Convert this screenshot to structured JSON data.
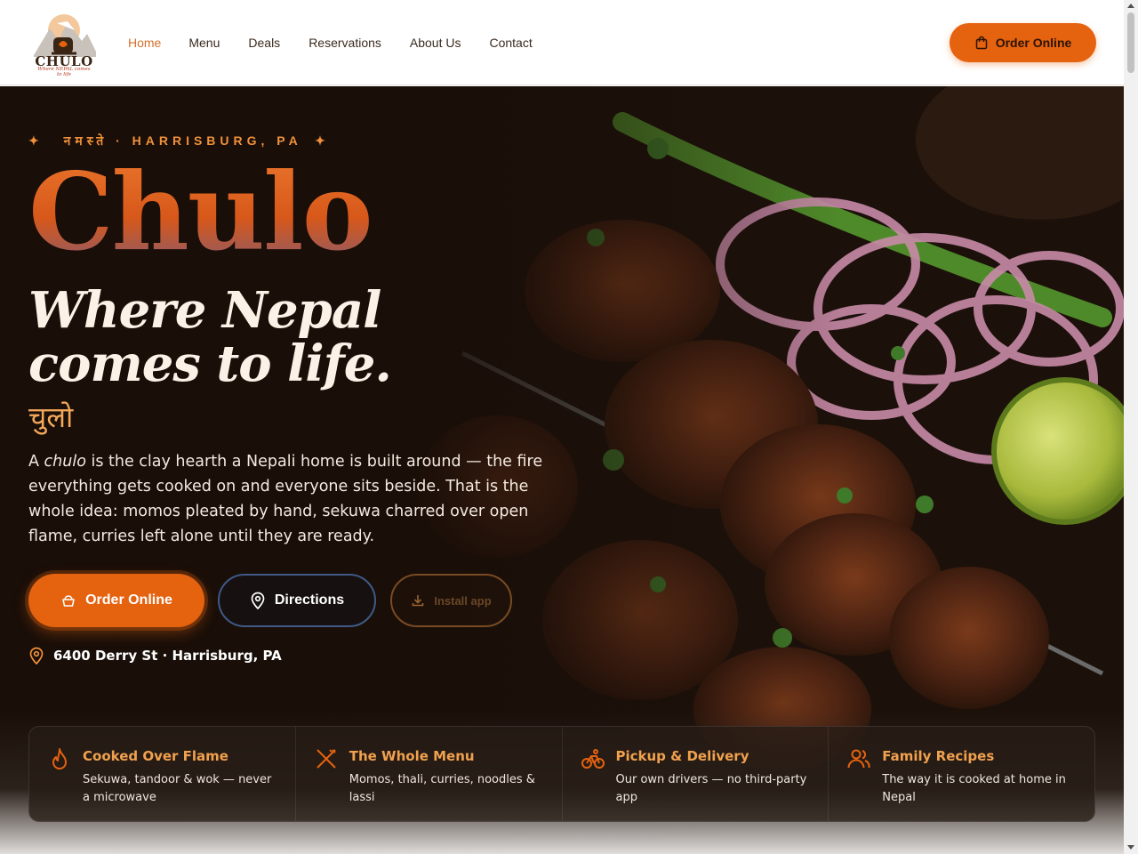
{
  "brand": {
    "logo_word": "CHULO",
    "logo_sub": "Where NEPAL comes to life"
  },
  "nav": {
    "items": [
      {
        "label": "Home",
        "active": true
      },
      {
        "label": "Menu"
      },
      {
        "label": "Deals"
      },
      {
        "label": "Reservations"
      },
      {
        "label": "About Us"
      },
      {
        "label": "Contact"
      }
    ],
    "order_button": "Order Online"
  },
  "hero": {
    "eyebrow": "नमस्ते · HARRISBURG, PA",
    "title": "Chulo",
    "tagline_line1": "Where Nepal",
    "tagline_line2": "comes to life.",
    "devanagari": "चुलो",
    "intro_prefix": "A ",
    "intro_em": "chulo",
    "intro_rest": " is the clay hearth a Nepali home is built around — the fire everything gets cooked on and everyone sits beside. That is the whole idea: momos pleated by hand, sekuwa charred over open flame, curries left alone until they are ready.",
    "buttons": {
      "order": "Order Online",
      "directions": "Directions",
      "install": "Install app"
    },
    "address": "6400 Derry St · Harrisburg, PA"
  },
  "features": [
    {
      "icon": "flame-icon",
      "title": "Cooked Over Flame",
      "text": "Sekuwa, tandoor & wok — never a microwave"
    },
    {
      "icon": "utensils-icon",
      "title": "The Whole Menu",
      "text": "Momos, thali, curries, noodles & lassi"
    },
    {
      "icon": "bicycle-icon",
      "title": "Pickup & Delivery",
      "text": "Our own drivers — no third-party app"
    },
    {
      "icon": "users-icon",
      "title": "Family Recipes",
      "text": "The way it is cooked at home in Nepal"
    }
  ],
  "colors": {
    "accent": "#e5620f",
    "eyebrow": "#f0913a",
    "feature_title": "#f1a14e",
    "nav_active": "#d7702a"
  }
}
